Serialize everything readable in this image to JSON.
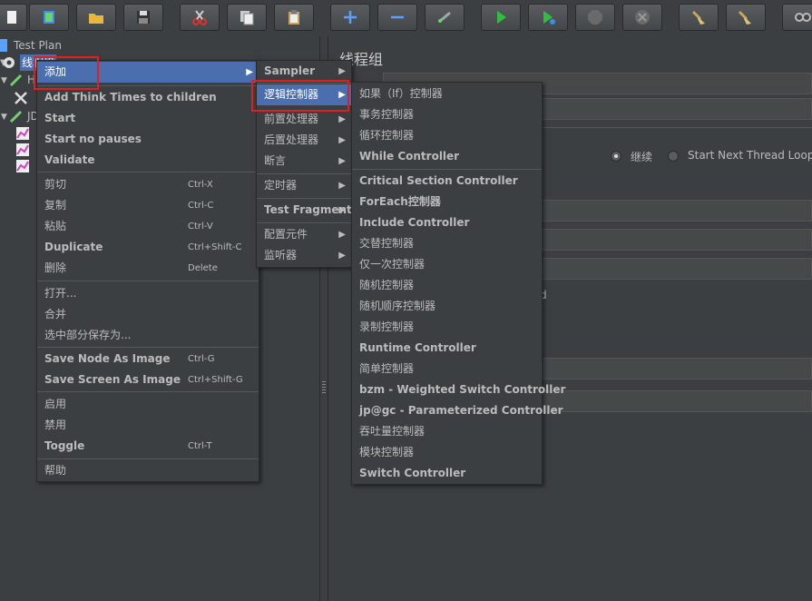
{
  "tree": {
    "test_plan": "Test Plan",
    "thread_group": "线程组",
    "child_h": "H",
    "child_jd": "JD"
  },
  "right": {
    "title": "线程组",
    "radio_continue": "继续",
    "radio_next_loop": "Start Next Thread Loop",
    "frag_d": "d"
  },
  "context_menu": {
    "add": "添加",
    "add_think_times": "Add Think Times to children",
    "start": "Start",
    "start_no_pauses": "Start no pauses",
    "validate": "Validate",
    "cut": "剪切",
    "cut_acc": "Ctrl-X",
    "copy": "复制",
    "copy_acc": "Ctrl-C",
    "paste": "粘贴",
    "paste_acc": "Ctrl-V",
    "duplicate": "Duplicate",
    "duplicate_acc": "Ctrl+Shift-C",
    "delete": "删除",
    "delete_acc": "Delete",
    "open": "打开...",
    "merge": "合并",
    "save_selection": "选中部分保存为...",
    "save_node_image": "Save Node As Image",
    "save_node_image_acc": "Ctrl-G",
    "save_screen_image": "Save Screen As Image",
    "save_screen_image_acc": "Ctrl+Shift-G",
    "enable": "启用",
    "disable": "禁用",
    "toggle": "Toggle",
    "toggle_acc": "Ctrl-T",
    "help": "帮助"
  },
  "add_submenu": {
    "sampler": "Sampler",
    "logic_controller": "逻辑控制器",
    "pre_processor": "前置处理器",
    "post_processor": "后置处理器",
    "assertion": "断言",
    "timer": "定时器",
    "test_fragment": "Test Fragment",
    "config_element": "配置元件",
    "listener": "监听器"
  },
  "logic_submenu": {
    "if_controller": "如果（If）控制器",
    "transaction_controller": "事务控制器",
    "loop_controller": "循环控制器",
    "while_controller": "While Controller",
    "critical_section": "Critical Section Controller",
    "foreach": "ForEach控制器",
    "include": "Include Controller",
    "interleave": "交替控制器",
    "once_only": "仅一次控制器",
    "random": "随机控制器",
    "random_order": "随机顺序控制器",
    "recording": "录制控制器",
    "runtime": "Runtime Controller",
    "simple": "简单控制器",
    "bzm_weighted": "bzm - Weighted Switch Controller",
    "jpgc_parameterized": "jp@gc - Parameterized Controller",
    "throughput": "吞吐量控制器",
    "module": "模块控制器",
    "switch": "Switch Controller"
  },
  "colors": {
    "background": "#3c3f41",
    "selection": "#4b6eaf",
    "highlight_box": "#e02020"
  },
  "icons": [
    "new-icon",
    "templates-icon",
    "open-icon",
    "save-icon",
    "cut-icon",
    "copy-icon",
    "paste-icon",
    "expand-icon",
    "collapse-icon",
    "toggle-icon",
    "start-icon",
    "start-no-pause-icon",
    "stop-icon",
    "shutdown-icon",
    "clear-icon",
    "clear-all-icon",
    "search-icon",
    "settings-gear-icon",
    "script-icon",
    "timer-icon"
  ]
}
